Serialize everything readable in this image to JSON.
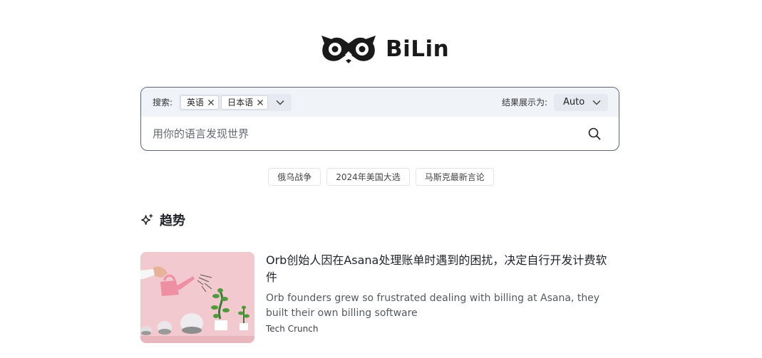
{
  "brand": {
    "name": "BiLin"
  },
  "search": {
    "label": "搜索:",
    "languages": [
      "英语",
      "日本语"
    ],
    "result_label": "结果展示为:",
    "result_mode": "Auto",
    "placeholder": "用你的语言发现世界"
  },
  "suggestions": [
    "俄乌战争",
    "2024年美国大选",
    "马斯克最新言论"
  ],
  "trending": {
    "title": "趋势",
    "articles": [
      {
        "title": "Orb创始人因在Asana处理账单时遇到的困扰，决定自行开发计费软件",
        "subtitle": "Orb founders grew so frustrated dealing with billing at Asana, they built their own billing software",
        "source": "Tech Crunch"
      }
    ]
  },
  "icons": {
    "logo": "owl-logo-icon",
    "remove": "close-icon",
    "expand": "chevron-down-icon",
    "search": "search-icon",
    "trending": "sparkle-icon"
  },
  "colors": {
    "border": "#5b6477",
    "toolbar_bg": "#f0f3f8",
    "thumb_bg": "#f2c9cf",
    "text": "#1f2329"
  }
}
